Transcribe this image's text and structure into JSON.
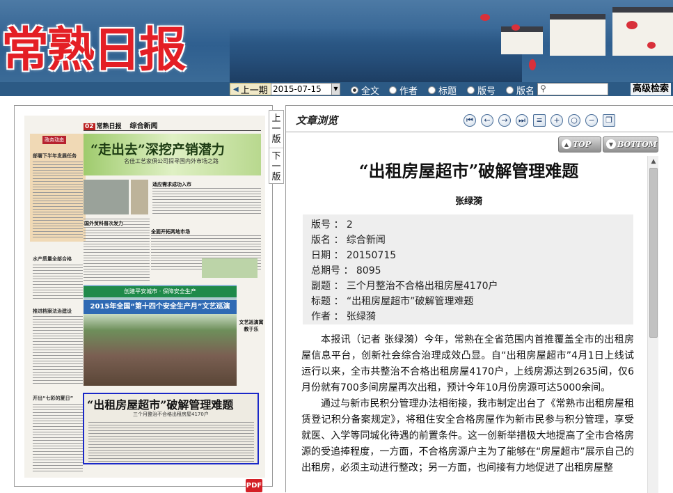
{
  "header": {
    "logo": "常熟日报"
  },
  "toolbar": {
    "prev_label": "上一期",
    "date_value": "2015-07-15",
    "search_options": [
      {
        "label": "全文",
        "selected": true
      },
      {
        "label": "作者",
        "selected": false
      },
      {
        "label": "标题",
        "selected": false
      },
      {
        "label": "版号",
        "selected": false
      },
      {
        "label": "版名",
        "selected": false
      }
    ],
    "search_value": "",
    "advanced_search": "高级检索"
  },
  "side_tabs": {
    "prev": "上一版",
    "next": "下一版"
  },
  "newspaper": {
    "page_number": "02",
    "paper_name": "常熟日报",
    "section": "综合新闻",
    "headline1": "“走出去”深挖产销潜力",
    "subhead1": "名佳工艺家俱公司探寻国内外市场之路",
    "left_tag": "政务动态",
    "left_headlines": [
      "部署下半年发展任务",
      "水产质量全部合格",
      "推进档案法治建设",
      "开出“七彩的夏日”"
    ],
    "mid_headlines": [
      "适应需求成功入市",
      "国外贸科普次发力",
      "全面开拓两地市场"
    ],
    "stage_banner_top": "创建平安城市 · 保障安全生产",
    "stage_banner": "2015年全国“第十四个安全生产月”文艺巡演",
    "side_caption": "文艺巡演寓教于乐",
    "highlight_title": "“出租房屋超市”破解管理难题",
    "highlight_sub": "三个月整治不合格出租房屋4170户"
  },
  "pdf_icon": "PDF",
  "article_panel": {
    "heading": "文章浏览",
    "nav_icons": [
      "first-page-icon",
      "prev-page-icon",
      "next-page-icon",
      "last-page-icon",
      "list-icon",
      "zoom-in-icon",
      "zoom-reset-icon",
      "zoom-out-icon",
      "copy-icon"
    ],
    "top_label": "TOP",
    "bottom_label": "BOTTOM"
  },
  "article": {
    "title": "“出租房屋超市”破解管理难题",
    "author": "张绿漪",
    "meta": [
      "版号 ： 2",
      "版名 ： 综合新闻",
      "日期 ： 20150715",
      "总期号 ： 8095",
      "副题 ： 三个月整治不合格出租房屋4170户",
      "标题 ： “出租房屋超市”破解管理难题",
      "作者 ： 张绿漪"
    ],
    "paragraphs": [
      "本报讯（记者 张绿漪）今年，常熟在全省范围内首推覆盖全市的出租房屋信息平台，创新社会综合治理成效凸显。自“出租房屋超市”4月1日上线试运行以来，全市共整治不合格出租房屋4170户，上线房源达到2635间，仅6月份就有700多间房屋再次出租，预计今年10月份房源可达5000余间。",
      "通过与新市民积分管理办法相衔接，我市制定出台了《常熟市出租房屋租赁登记积分备案规定》，将租住安全合格房屋作为新市民参与积分管理，享受就医、入学等同城化待遇的前置条件。这一创新举措极大地提高了全市合格房源的受追捧程度，一方面，不合格房源户主为了能够在“房屋超市”展示自己的出租房，必须主动进行整改；另一方面，也间接有力地促进了出租房屋整"
    ]
  },
  "colors": {
    "header_blue": "#2c5a85",
    "logo_red": "#e41f25",
    "highlight_border": "#1a28c8"
  }
}
